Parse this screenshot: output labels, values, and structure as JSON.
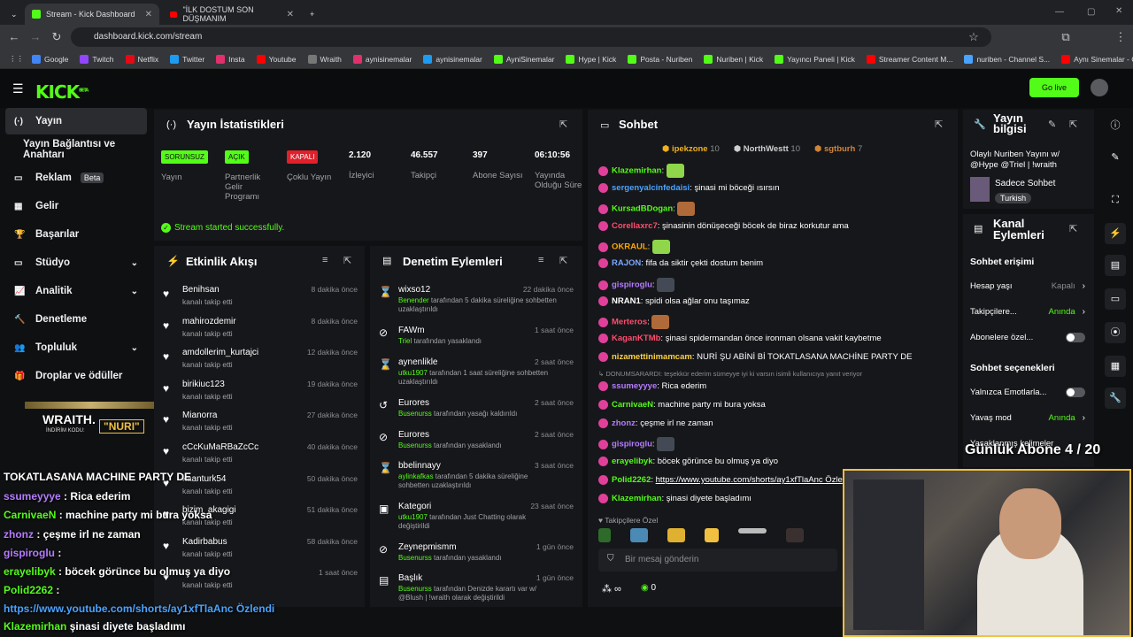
{
  "browser": {
    "tabs": [
      {
        "title": "Stream - Kick Dashboard",
        "active": true
      },
      {
        "title": "\"İLK DOSTUM SON DÜŞMANIM",
        "active": false
      }
    ],
    "url": "dashboard.kick.com/stream",
    "bookmarks": [
      "Google",
      "Twitch",
      "Netflix",
      "Twitter",
      "Insta",
      "Youtube",
      "Wraith",
      "aynisinemalar",
      "aynisinemalar",
      "AyniSinemalar",
      "Hype | Kick",
      "Posta - Nuriben",
      "Nuriben | Kick",
      "Yayıncı Paneli | Kick",
      "Streamer Content M...",
      "nuriben - Channel S...",
      "Aynı Sinemalar - Ça..."
    ]
  },
  "header": {
    "logo": "KICK",
    "logo_sup": "BETA",
    "go_live": "Go live"
  },
  "sidebar": {
    "items": [
      {
        "label": "Yayın",
        "icon": "broadcast-icon"
      },
      {
        "label": "Yayın Bağlantısı ve Anahtarı",
        "icon": ""
      },
      {
        "label": "Reklam",
        "icon": "ad-icon",
        "badge": "Beta"
      },
      {
        "label": "Gelir",
        "icon": "revenue-icon"
      },
      {
        "label": "Başarılar",
        "icon": "trophy-icon"
      },
      {
        "label": "Stüdyo",
        "icon": "studio-icon"
      },
      {
        "label": "Analitik",
        "icon": "analytics-icon"
      },
      {
        "label": "Denetleme",
        "icon": "hammer-icon"
      },
      {
        "label": "Topluluk",
        "icon": "community-icon"
      },
      {
        "label": "Droplar ve ödüller",
        "icon": "gift-icon"
      }
    ],
    "sponsor": {
      "brand": "WRAITH.",
      "code_label": "İNDİRİM KODU:",
      "code": "\"NURI\""
    }
  },
  "stats": {
    "title": "Yayın İstatistikleri",
    "items": [
      {
        "pill": "SORUNSUZ",
        "label": "Yayın",
        "color": "#53fc18"
      },
      {
        "pill": "AÇIK",
        "label": "Partnerlik Gelir Programı",
        "color": "#53fc18"
      },
      {
        "pill": "KAPALI",
        "label": "Çoklu Yayın",
        "color": "#e0202a"
      },
      {
        "value": "2.120",
        "label": "İzleyici"
      },
      {
        "value": "46.557",
        "label": "Takipçi"
      },
      {
        "value": "397",
        "label": "Abone Sayısı"
      },
      {
        "value": "06:10:56",
        "label": "Yayında Olduğu Süre"
      }
    ],
    "status": "Stream started successfully."
  },
  "activity": {
    "title": "Etkinlik Akışı",
    "rows": [
      {
        "name": "Benihsan",
        "sub": "kanalı takip etti",
        "time": "8 dakika önce"
      },
      {
        "name": "mahirozdemir",
        "sub": "kanalı takip etti",
        "time": "8 dakika önce"
      },
      {
        "name": "amdollerim_kurtajci",
        "sub": "kanalı takip etti",
        "time": "12 dakika önce"
      },
      {
        "name": "birikiuc123",
        "sub": "kanalı takip etti",
        "time": "19 dakika önce"
      },
      {
        "name": "Mianorra",
        "sub": "kanalı takip etti",
        "time": "27 dakika önce"
      },
      {
        "name": "cCcKuMaRBaZcCc",
        "sub": "kanalı takip etti",
        "time": "40 dakika önce"
      },
      {
        "name": "kaanturk54",
        "sub": "kanalı takip etti",
        "time": "50 dakika önce"
      },
      {
        "name": "bizim_akagigi",
        "sub": "kanalı takip etti",
        "time": "51 dakika önce"
      },
      {
        "name": "Kadirbabus",
        "sub": "kanalı takip etti",
        "time": "58 dakika önce"
      },
      {
        "name": "",
        "sub": "kanalı takip etti",
        "time": "1 saat önce"
      }
    ]
  },
  "moderation": {
    "title": "Denetim Eylemleri",
    "rows": [
      {
        "icon": "hourglass-icon",
        "glyph": "⌛",
        "name": "wixso12",
        "by": "Benender",
        "sub": " tarafından 5 dakika süreliğine sohbetten uzaklaştırıldı",
        "time": "22 dakika önce"
      },
      {
        "icon": "ban-icon",
        "glyph": "⊘",
        "name": "FAWm",
        "by": "Triel",
        "sub": " tarafından yasaklandı",
        "time": "1 saat önce"
      },
      {
        "icon": "hourglass-icon",
        "glyph": "⌛",
        "name": "aynenlikle",
        "by": "utku1907",
        "sub": " tarafından 1 saat süreliğine sohbetten uzaklaştırıldı",
        "time": "2 saat önce"
      },
      {
        "icon": "undo-icon",
        "glyph": "↺",
        "name": "Eurores",
        "by": "Busenurss",
        "sub": " tarafından yasağı kaldırıldı",
        "time": "2 saat önce"
      },
      {
        "icon": "ban-icon",
        "glyph": "⊘",
        "name": "Eurores",
        "by": "Busenurss",
        "sub": " tarafından yasaklandı",
        "time": "2 saat önce"
      },
      {
        "icon": "hourglass-icon",
        "glyph": "⌛",
        "name": "bbelinnayy",
        "by": "aylinkafkas",
        "sub": " tarafından 5 dakika süreliğine sohbetten uzaklaştırıldı",
        "time": "3 saat önce"
      },
      {
        "icon": "category-icon",
        "glyph": "▣",
        "name": "Kategori",
        "by": "utku1907",
        "sub": " tarafından Just Chatting olarak değiştirildi",
        "time": "23 saat önce"
      },
      {
        "icon": "ban-icon",
        "glyph": "⊘",
        "name": "Zeynepmismm",
        "by": "Busenurss",
        "sub": " tarafından yasaklandı",
        "time": "1 gün önce"
      },
      {
        "icon": "title-icon",
        "glyph": "▤",
        "name": "Başlık",
        "by": "Busenurss",
        "sub": " tarafından Denizde karartı var w/ @Blush | !wraith olarak değiştirildi",
        "time": "1 gün önce"
      }
    ]
  },
  "chat": {
    "title": "Sohbet",
    "top": [
      {
        "name": "ipekzone",
        "count": "10",
        "color": "#f0b020"
      },
      {
        "name": "NorthWestt",
        "count": "10",
        "color": "#cfcfcf"
      },
      {
        "name": "sgtburh",
        "count": "7",
        "color": "#d0843a"
      }
    ],
    "messages": [
      {
        "user": "Klazemirhan",
        "color": "#53fc18",
        "text": "",
        "emote": "#8fd64a"
      },
      {
        "user": "sergenyalcinfedaisi",
        "color": "#4aa3ff",
        "text": "şinasi mi böceği ısırsın"
      },
      {
        "user": "KursadBDogan",
        "color": "#53fc18",
        "text": "",
        "emote": "#b06a3a"
      },
      {
        "user": "Corellaxrc7",
        "color": "#ff4d6d",
        "text": "şinasinin dönüşeceği böcek de biraz korkutur ama"
      },
      {
        "user": "OKRAUL",
        "color": "#ffa500",
        "text": "",
        "emote": "#8fd64a"
      },
      {
        "user": "RAJON",
        "color": "#7aa7ff",
        "text": "fifa da siktir çekti dostum benim"
      },
      {
        "user": "gispiroglu",
        "color": "#b57cff",
        "text": "",
        "emote": "#444a55"
      },
      {
        "user": "NRAN1",
        "color": "#ffffff",
        "text": "spidi olsa ağlar onu taşımaz"
      },
      {
        "user": "Merteros",
        "color": "#ff4d6d",
        "text": "",
        "emote": "#b06a3a"
      },
      {
        "user": "KaganKTMb",
        "color": "#ff4d6d",
        "text": "şinasi spidermandan önce ironman olsana vakit kaybetme"
      },
      {
        "user": "nizamettinimamcam",
        "color": "#ffd23f",
        "text": "NURİ ŞU ABİNİ Bİ TOKATLASANA MACHİNE PARTY DE"
      },
      {
        "user": "DONUMSARARDI",
        "color": "#8a8d92",
        "text": "teşekkür ederim sümeyye iyi ki varsın isimli kullanıcıya yanıt veriyor",
        "reply": true
      },
      {
        "user": "ssumeyyye",
        "color": "#b57cff",
        "text": "Rica ederim"
      },
      {
        "user": "CarnivaeN",
        "color": "#53fc18",
        "text": "machine party mi bura yoksa"
      },
      {
        "user": "zhonz",
        "color": "#b57cff",
        "text": "çeşme irl ne zaman"
      },
      {
        "user": "gispiroglu",
        "color": "#b57cff",
        "text": "",
        "emote": "#444a55"
      },
      {
        "user": "erayelibyk",
        "color": "#53fc18",
        "text": "böcek görünce bu olmuş ya diyo"
      },
      {
        "user": "Polid2262",
        "color": "#53fc18",
        "text": "https://www.youtube.com/shorts/ay1xfTlaAnc Özle",
        "link": true
      },
      {
        "user": "Klazemirhan",
        "color": "#53fc18",
        "text": "şinasi diyete başladımı"
      }
    ],
    "follower_only": "Takipçilere Özel",
    "input_placeholder": "Bir mesaj gönderin",
    "footer_count": "0"
  },
  "stream_info": {
    "title": "Yayın bilgisi",
    "description": "Olaylı Nuriben Yayını w/ @Hype @Triel | !wraith",
    "category": "Sadece Sohbet",
    "language": "Turkish"
  },
  "channel_actions": {
    "title": "Kanal Eylemleri",
    "chat_access": "Sohbet erişimi",
    "rows": [
      {
        "label": "Hesap yaşı",
        "value": "Kapalı"
      },
      {
        "label": "Takipçilere...",
        "value": "Anında"
      },
      {
        "label": "Abonelere özel...",
        "value": ""
      }
    ],
    "chat_options": "Sohbet seçenekleri",
    "opt_rows": [
      {
        "label": "Yalnızca Emotlarla...",
        "value": ""
      },
      {
        "label": "Yavaş mod",
        "value": "Anında"
      },
      {
        "label": "Yasaklanmış kelimeler",
        "value": ""
      }
    ]
  },
  "overlay": {
    "sub_goal": "Günlük Abone 4 / 20",
    "lines": [
      {
        "user": "",
        "text": "TOKATLASANA MACHINE PARTY DE",
        "color": "#ffffff"
      },
      {
        "user": "ssumeyyye",
        "text": " : Rica ederim",
        "color": "#b57cff"
      },
      {
        "user": "CarnivaeN",
        "text": " : machine party mi bura yoksa",
        "color": "#53fc18"
      },
      {
        "user": "zhonz",
        "text": " : çeşme irl ne zaman",
        "color": "#b57cff"
      },
      {
        "user": "gispiroglu",
        "text": " :",
        "color": "#b57cff"
      },
      {
        "user": "erayelibyk",
        "text": " : böcek görünce bu olmuş ya diyo",
        "color": "#53fc18"
      },
      {
        "user": "Polid2262",
        "text": " :",
        "color": "#53fc18"
      },
      {
        "user": "",
        "text": "https://www.youtube.com/shorts/ay1xfTlaAnc Özlendi",
        "color": "#4aa3ff"
      },
      {
        "user": "Klazemirhan",
        "text": " şinasi diyete başladımı",
        "color": "#53fc18"
      }
    ]
  }
}
